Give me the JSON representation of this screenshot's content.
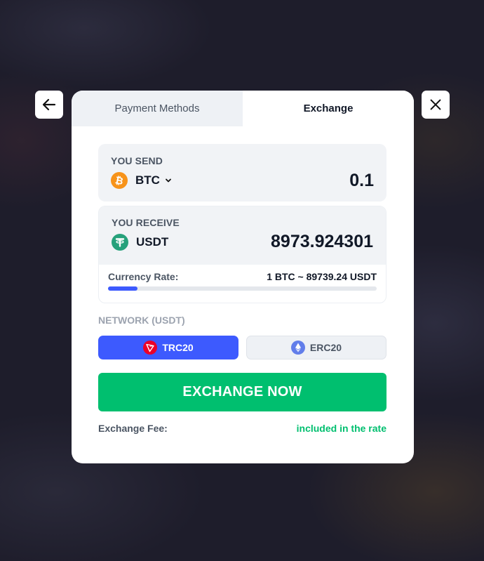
{
  "tabs": [
    {
      "label": "Payment Methods",
      "active": false
    },
    {
      "label": "Exchange",
      "active": true
    }
  ],
  "send": {
    "label": "YOU SEND",
    "currency": "BTC",
    "currency_icon": "bitcoin-icon",
    "amount": "0.1"
  },
  "receive": {
    "label": "YOU RECEIVE",
    "currency": "USDT",
    "currency_icon": "tether-icon",
    "amount": "8973.924301"
  },
  "rate": {
    "label": "Currency Rate:",
    "value": "1 BTC ~ 89739.24 USDT",
    "progress_percent": 11
  },
  "network": {
    "label": "NETWORK (USDT)",
    "options": [
      {
        "label": "TRC20",
        "icon": "tron-icon",
        "selected": true
      },
      {
        "label": "ERC20",
        "icon": "ethereum-icon",
        "selected": false
      }
    ]
  },
  "exchange_button": "EXCHANGE NOW",
  "fee": {
    "label": "Exchange Fee:",
    "value": "included in the rate"
  },
  "colors": {
    "accent_blue": "#3d5afe",
    "success_green": "#00bf6f",
    "bitcoin_orange": "#f7931a",
    "tether_green": "#26a17b",
    "tron_red": "#eb0029",
    "ethereum_purple": "#627eea"
  }
}
